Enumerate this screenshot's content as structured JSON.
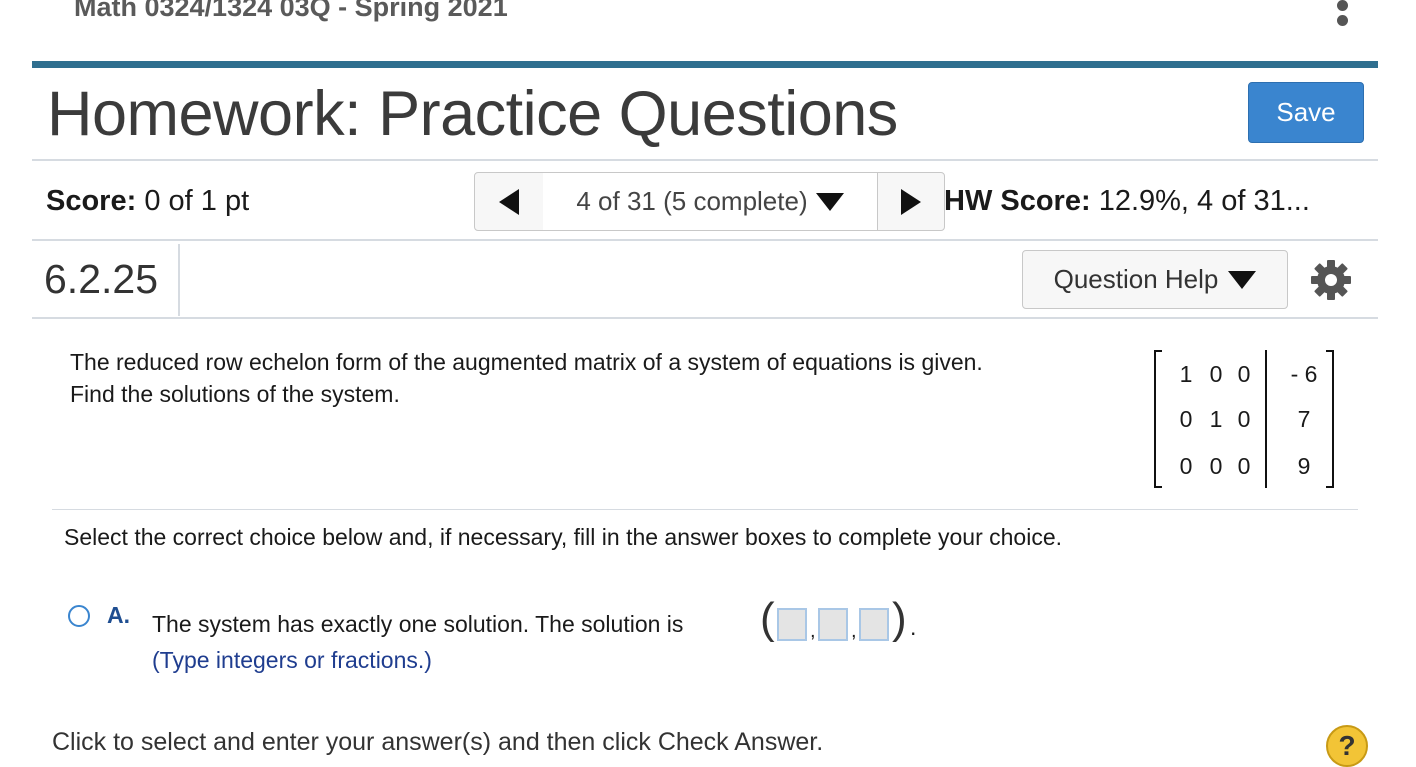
{
  "header": {
    "course": "Math 0324/1324 03Q - Spring 2021",
    "title": "Homework: Practice Questions",
    "save_label": "Save"
  },
  "score": {
    "label": "Score:",
    "value": "0 of 1 pt"
  },
  "navigation": {
    "current": "4 of 31 (5 complete)"
  },
  "hw_score": {
    "label": "HW Score:",
    "value": "12.9%, 4 of 31..."
  },
  "question": {
    "number": "6.2.25",
    "help_label": "Question Help",
    "text_line1": "The reduced row echelon form of the augmented matrix of a system of equations is given.",
    "text_line2": "Find the solutions of the system.",
    "matrix": [
      [
        "1",
        "0",
        "0",
        "- 6"
      ],
      [
        "0",
        "1",
        "0",
        "7"
      ],
      [
        "0",
        "0",
        "0",
        "9"
      ]
    ],
    "instruction": "Select the correct choice below and, if necessary, fill in the answer boxes to complete your choice."
  },
  "choice_a": {
    "letter": "A.",
    "text": "The system has exactly one solution. The solution is",
    "hint": "(Type integers or fractions.)",
    "answers": [
      "",
      "",
      ""
    ]
  },
  "footer": {
    "text": "Click to select and enter your answer(s) and then click Check Answer.",
    "help_symbol": "?"
  },
  "colors": {
    "accent_bar": "#2f6f8f",
    "save_button": "#3a85cf",
    "help_icon": "#f2c436"
  },
  "icons": [
    "more-vertical-icon",
    "triangle-left-icon",
    "triangle-down-icon",
    "triangle-right-icon",
    "gear-icon",
    "question-circle-icon"
  ]
}
